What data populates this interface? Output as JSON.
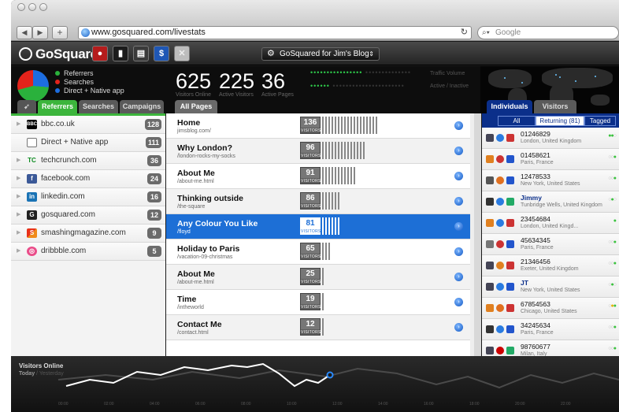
{
  "browser": {
    "url": "www.gosquared.com/livestats",
    "search_placeholder": "Google"
  },
  "app": {
    "logo": "GoSquared",
    "site_selector": "GoSquared for Jim's Blog"
  },
  "summary": {
    "legend": [
      "Referrers",
      "Searches",
      "Direct + Native app"
    ],
    "legend_colors": [
      "#2ab13c",
      "#e3231b",
      "#1d6de0"
    ],
    "stats": [
      {
        "value": "625",
        "label": "Visitors Online"
      },
      {
        "value": "225",
        "label": "Active Visitors"
      },
      {
        "value": "36",
        "label": "Active Pages"
      }
    ],
    "traffic_volume_label": "Traffic Volume",
    "active_inactive_label": "Active / Inactive"
  },
  "left_tabs": [
    "Referrers",
    "Searches",
    "Campaigns"
  ],
  "referrers": [
    {
      "name": "bbc.co.uk",
      "count": "128",
      "icon": "bbc-icon"
    },
    {
      "name": "Direct + Native app",
      "count": "111",
      "icon": "window-icon"
    },
    {
      "name": "techcrunch.com",
      "count": "36",
      "icon": "techcrunch-icon"
    },
    {
      "name": "facebook.com",
      "count": "24",
      "icon": "facebook-icon"
    },
    {
      "name": "linkedin.com",
      "count": "16",
      "icon": "linkedin-icon"
    },
    {
      "name": "gosquared.com",
      "count": "12",
      "icon": "gosquared-icon"
    },
    {
      "name": "smashingmagazine.com",
      "count": "9",
      "icon": "smashing-icon"
    },
    {
      "name": "dribbble.com",
      "count": "5",
      "icon": "dribbble-icon"
    }
  ],
  "pages_tab": "All Pages",
  "visitors_label": "VISITORS",
  "pages": [
    {
      "title": "Home",
      "path": "jimsblog.com/",
      "visitors": "136"
    },
    {
      "title": "Why London?",
      "path": "/london-rocks-my-socks",
      "visitors": "96"
    },
    {
      "title": "About Me",
      "path": "/about-me.html",
      "visitors": "91"
    },
    {
      "title": "Thinking outside",
      "path": "/the-square",
      "visitors": "86"
    },
    {
      "title": "Any Colour You Like",
      "path": "/floyd",
      "visitors": "81",
      "selected": true
    },
    {
      "title": "Holiday to Paris",
      "path": "/vacation-09-christmas",
      "visitors": "65"
    },
    {
      "title": "About Me",
      "path": "/about-me.html",
      "visitors": "25"
    },
    {
      "title": "Time",
      "path": "/intheworld",
      "visitors": "19"
    },
    {
      "title": "Contact Me",
      "path": "/contact.html",
      "visitors": "12"
    }
  ],
  "right_tabs": [
    "Individuals",
    "Visitors"
  ],
  "right_filters": [
    "All",
    "Returning (81)",
    "Tagged"
  ],
  "individuals": [
    {
      "id": "01246829",
      "location": "London, United Kingdom"
    },
    {
      "id": "01458621",
      "location": "Paris, France"
    },
    {
      "id": "12478533",
      "location": "New York, United States"
    },
    {
      "id": "Jimmy",
      "location": "Tunbridge Wells, United Kingdom",
      "tagged": true
    },
    {
      "id": "23454684",
      "location": "London, United Kingd..."
    },
    {
      "id": "45634345",
      "location": "Paris, France"
    },
    {
      "id": "21346456",
      "location": "Exeter, United Kingdom"
    },
    {
      "id": "JT",
      "location": "New York, United States",
      "tagged": true
    },
    {
      "id": "67854563",
      "location": "Chicago, United States"
    },
    {
      "id": "34245634",
      "location": "Paris, France"
    },
    {
      "id": "98760677",
      "location": "Milan, Italy"
    }
  ],
  "graph": {
    "title": "Visitors Online",
    "today": "Today",
    "separator": " / ",
    "yesterday": "Yesterday",
    "times": [
      "00:00",
      "02:00",
      "04:00",
      "06:00",
      "08:00",
      "10:00",
      "12:00",
      "14:00",
      "16:00",
      "18:00",
      "20:00",
      "22:00"
    ]
  }
}
